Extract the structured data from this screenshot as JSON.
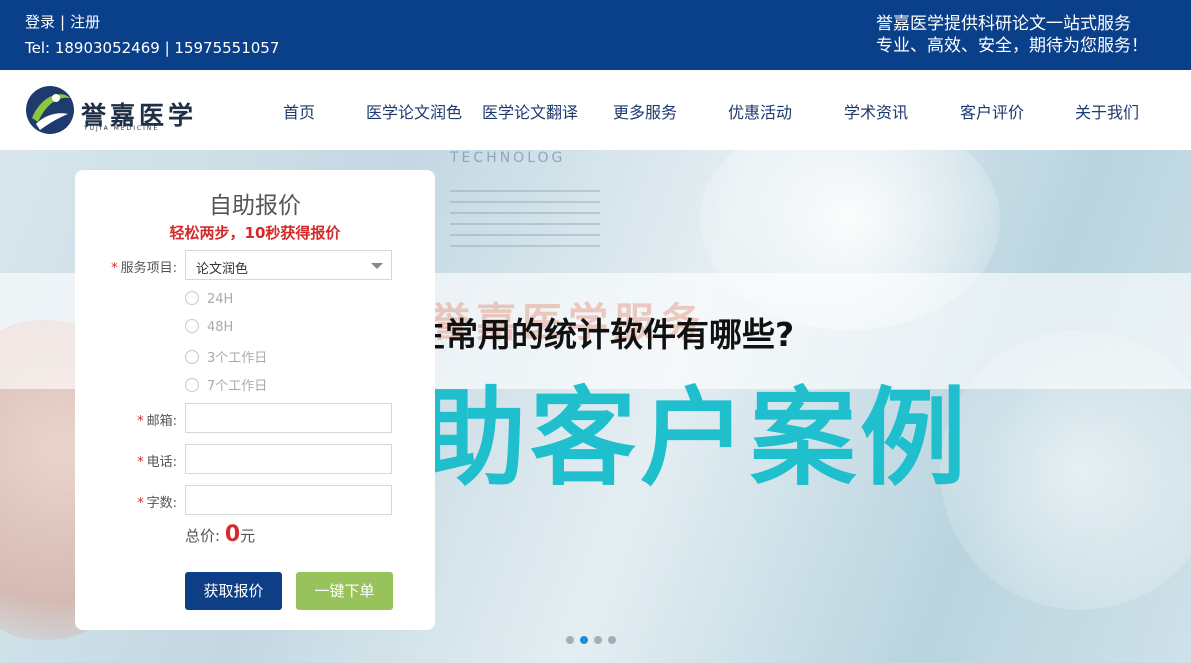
{
  "topbar": {
    "login": "登录",
    "separator": "|",
    "register": "注册",
    "tel": "Tel: 18903052469 | 15975551057",
    "slogan_line1": "誉嘉医学提供科研论文一站式服务",
    "slogan_line2": "专业、高效、安全，期待为您服务！"
  },
  "brand": {
    "name": "誉嘉医学",
    "sub": "YUJIA MEDICINE"
  },
  "nav": {
    "items": [
      {
        "label": "首页"
      },
      {
        "label": "医学论文润色"
      },
      {
        "label": "医学论文翻译"
      },
      {
        "label": "更多服务"
      },
      {
        "label": "优惠活动"
      },
      {
        "label": "学术资讯"
      },
      {
        "label": "客户评价"
      },
      {
        "label": "关于我们"
      }
    ]
  },
  "hero": {
    "watermark": "TECHNOLOG",
    "banner_script": "誉嘉医学服务",
    "banner_text": "助客户案例",
    "headline": "医学生常用的统计软件有哪些?",
    "slides_total": 4,
    "active_slide": 2
  },
  "form": {
    "title": "自助报价",
    "subtitle": "轻松两步，10秒获得报价",
    "required_mark": "*",
    "service_label": "服务项目:",
    "service_value": "论文润色",
    "turnaround_options": [
      "24H",
      "48H",
      "3个工作日",
      "7个工作日"
    ],
    "email_label": "邮箱:",
    "phone_label": "电话:",
    "words_label": "字数:",
    "total_label": "总价:",
    "total_value": "0",
    "currency": "元",
    "quote_button": "获取报价",
    "order_button": "一键下单"
  },
  "colors": {
    "topbar_bg": "#0a3f8a",
    "nav_text": "#1d3a6e",
    "accent_red": "#d42a2a",
    "quote_button": "#0e3f86",
    "order_button": "#98c25b",
    "banner_cyan": "#1fbfcd"
  }
}
